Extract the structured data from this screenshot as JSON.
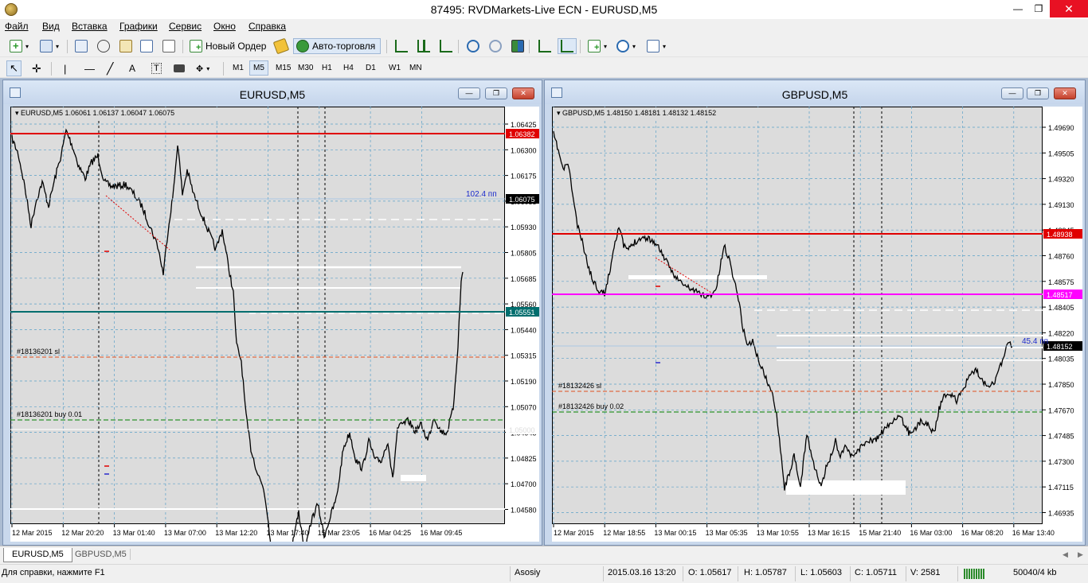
{
  "window": {
    "title": "87495: RVDMarkets-Live ECN - EURUSD,M5",
    "min_glyph": "—",
    "max_glyph": "❐",
    "close_glyph": "✕"
  },
  "menu": [
    "Файл",
    "Вид",
    "Вставка",
    "Графики",
    "Сервис",
    "Окно",
    "Справка"
  ],
  "toolbar": {
    "new_order_label": "Новый Ордер",
    "autotrading_label": "Авто-торговля",
    "timeframes": [
      "M1",
      "M5",
      "M15",
      "M30",
      "H1",
      "H4",
      "D1",
      "W1",
      "MN"
    ],
    "active_timeframe": "M5",
    "search_value": ""
  },
  "charts": [
    {
      "window_title": "EURUSD,M5",
      "info_line": "EURUSD,M5  1.06061 1.06137 1.06047 1.06075",
      "price_labels": [
        "1.06425",
        "1.06300",
        "1.06175",
        "1.06055",
        "1.05930",
        "1.05805",
        "1.05685",
        "1.05560",
        "1.05440",
        "1.05315",
        "1.05190",
        "1.05070",
        "1.04945",
        "1.04825",
        "1.04700",
        "1.04580"
      ],
      "time_labels": [
        "12 Mar 2015",
        "12 Mar 20:20",
        "13 Mar 01:40",
        "13 Mar 07:00",
        "13 Mar 12:20",
        "13 Mar 17:40",
        "15 Mar 23:05",
        "16 Mar 04:25",
        "16 Mar 09:45"
      ],
      "current_price": "1.06075",
      "red_level_label": "1.06382",
      "teal_level_label": "1.05551",
      "white_level_label": "1.05000",
      "pips_label": "102.4 пп",
      "sl_label": "#18136201 sl",
      "order_label": "#18136201 buy 0.01"
    },
    {
      "window_title": "GBPUSD,M5",
      "info_line": "GBPUSD,M5  1.48150 1.48181 1.48132 1.48152",
      "price_labels": [
        "1.49690",
        "1.49505",
        "1.49320",
        "1.49130",
        "1.48945",
        "1.48760",
        "1.48575",
        "1.48405",
        "1.48220",
        "1.48035",
        "1.47850",
        "1.47670",
        "1.47485",
        "1.47300",
        "1.47115",
        "1.46935"
      ],
      "time_labels": [
        "12 Mar 2015",
        "12 Mar 18:55",
        "13 Mar 00:15",
        "13 Mar 05:35",
        "13 Mar 10:55",
        "13 Mar 16:15",
        "15 Mar 21:40",
        "16 Mar 03:00",
        "16 Mar 08:20",
        "16 Mar 13:40"
      ],
      "current_price": "1.48152",
      "red_level_label": "1.48938",
      "magenta_level_label": "1.48517",
      "pips_label": "45.4 пп",
      "sl_label": "#18132426 sl",
      "order_label": "#18132426 buy 0.02"
    }
  ],
  "tabs": [
    "EURUSD,M5",
    "GBPUSD,M5"
  ],
  "status": {
    "help": "Для справки, нажмите F1",
    "profile": "Asosiy",
    "datetime": "2015.03.16 13:20",
    "open": "O: 1.05617",
    "high": "H: 1.05787",
    "low": "L: 1.05603",
    "close": "C: 1.05711",
    "volume": "V: 2581",
    "traffic": "50040/4 kb"
  },
  "colors": {
    "red_line": "#e00000",
    "teal_line": "#006e6e",
    "magenta_line": "#ff00ff",
    "sl_line": "#e05020",
    "order_line": "#008000",
    "grid": "#5aa0c8",
    "price_line": "#000000"
  }
}
